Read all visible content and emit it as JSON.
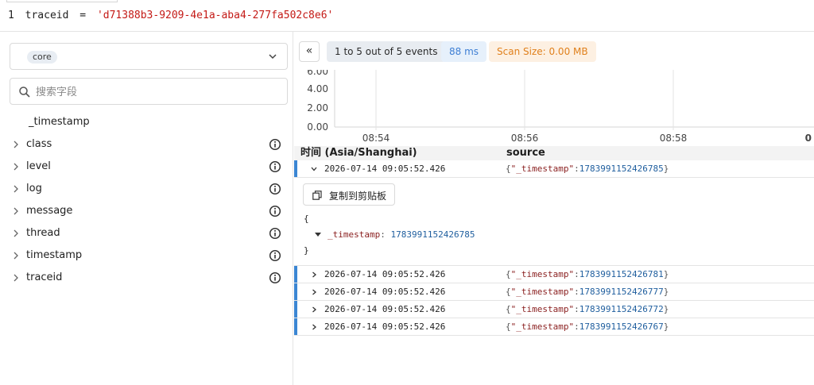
{
  "query": {
    "line_number": "1",
    "field": "traceid",
    "operator": "=",
    "value": "'d71388b3-9209-4e1a-aba4-277fa502c8e6'"
  },
  "sidebar": {
    "stream": "core",
    "search_placeholder": "搜索字段",
    "fields": [
      {
        "name": "_timestamp",
        "expandable": false
      },
      {
        "name": "class",
        "expandable": true
      },
      {
        "name": "level",
        "expandable": true
      },
      {
        "name": "log",
        "expandable": true
      },
      {
        "name": "message",
        "expandable": true
      },
      {
        "name": "thread",
        "expandable": true
      },
      {
        "name": "timestamp",
        "expandable": true
      },
      {
        "name": "traceid",
        "expandable": true
      }
    ]
  },
  "toolbar": {
    "collapse_label": "«",
    "events_label": "1 to 5 out of 5 events",
    "took_label": "88 ms",
    "scan_label": "Scan Size: 0.00 MB"
  },
  "chart_data": {
    "type": "bar",
    "y_ticks": [
      "6.00",
      "4.00",
      "2.00",
      "0.00"
    ],
    "x_ticks": [
      "08:54",
      "08:56",
      "08:58",
      "0"
    ],
    "values": [],
    "grid": true
  },
  "table": {
    "columns": [
      "时间 (Asia/Shanghai)",
      "source"
    ],
    "source_key": "\"_timestamp\"",
    "rows": [
      {
        "time": "2026-07-14 09:05:52.426",
        "timestamp": "1783991152426785",
        "expanded": true
      },
      {
        "time": "2026-07-14 09:05:52.426",
        "timestamp": "1783991152426781",
        "expanded": false
      },
      {
        "time": "2026-07-14 09:05:52.426",
        "timestamp": "1783991152426777",
        "expanded": false
      },
      {
        "time": "2026-07-14 09:05:52.426",
        "timestamp": "1783991152426772",
        "expanded": false
      },
      {
        "time": "2026-07-14 09:05:52.426",
        "timestamp": "1783991152426767",
        "expanded": false
      }
    ]
  },
  "detail": {
    "copy_label": "复制到剪贴板",
    "open_brace": "{",
    "close_brace": "}",
    "key": "_timestamp",
    "value": "1783991152426785"
  },
  "colors": {
    "accent": "#3b86d3",
    "string": "#c41a16",
    "json_key": "#8a1f1f",
    "json_value": "#1f5e9e",
    "took_text": "#3f7fd4",
    "scan_text": "#e0801c"
  }
}
